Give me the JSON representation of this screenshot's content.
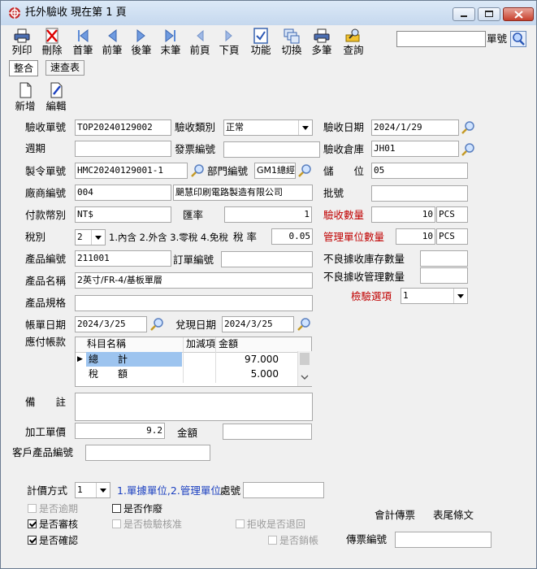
{
  "window": {
    "title": "托外驗收  現在第 1 頁"
  },
  "toolbar": {
    "buttons": [
      {
        "label": "列印",
        "icon": "printer-icon"
      },
      {
        "label": "刪除",
        "icon": "delete-icon"
      },
      {
        "label": "首筆",
        "icon": "first-record-icon"
      },
      {
        "label": "前筆",
        "icon": "prev-record-icon"
      },
      {
        "label": "後筆",
        "icon": "next-record-icon"
      },
      {
        "label": "末筆",
        "icon": "last-record-icon"
      },
      {
        "label": "前頁",
        "icon": "prev-page-icon"
      },
      {
        "label": "下頁",
        "icon": "next-page-icon"
      },
      {
        "label": "功能",
        "icon": "function-icon"
      },
      {
        "label": "切換",
        "icon": "switch-icon"
      },
      {
        "label": "多筆",
        "icon": "multi-record-icon"
      },
      {
        "label": "查詢",
        "icon": "query-icon"
      }
    ],
    "search_value": "",
    "search_label": "單號"
  },
  "tabs": [
    {
      "label": "整合"
    },
    {
      "label": "速查表"
    }
  ],
  "actions": [
    {
      "label": "新增",
      "icon": "new-doc-icon"
    },
    {
      "label": "編輯",
      "icon": "edit-doc-icon"
    }
  ],
  "form": {
    "receipt_no_label": "驗收單號",
    "receipt_no": "TOP20240129002",
    "receipt_type_label": "驗收類別",
    "receipt_type": "正常",
    "receipt_date_label": "驗收日期",
    "receipt_date": "2024/1/29",
    "period_label": "週期",
    "period": "",
    "invoice_no_label": "發票編號",
    "invoice_no": "",
    "warehouse_label": "驗收倉庫",
    "warehouse": "JH01",
    "order_no_label": "製令單號",
    "order_no": "HMC20240129001-1",
    "dept_label": "部門編號",
    "dept": "GM1總經",
    "location_label": "儲　　位",
    "location": "05",
    "vendor_label": "廠商編號",
    "vendor_code": "004",
    "vendor_name": "颶慧印刷電路製造有限公司",
    "batch_label": "批號",
    "batch": "",
    "currency_label": "付款幣別",
    "currency": "NT$",
    "rate_label": "匯率",
    "rate": "1",
    "qty_label": "驗收數量",
    "qty": "10",
    "qty_unit": "PCS",
    "tax_label": "稅別",
    "tax_value": "2",
    "tax_hint": "1.內含 2.外含 3.零稅 4.免稅",
    "tax_rate_label": "稅 率",
    "tax_rate": "0.05",
    "mgmt_qty_label": "管理單位數量",
    "mgmt_qty": "10",
    "mgmt_unit": "PCS",
    "product_no_label": "產品編號",
    "product_no": "211001",
    "order_ref_label": "訂單編號",
    "order_ref": "",
    "bad_stock_label": "不良據收庫存數量",
    "bad_stock": "",
    "product_name_label": "產品名稱",
    "product_name": "2英寸/FR-4/基板單層",
    "bad_mgmt_label": "不良據收管理數量",
    "bad_mgmt": "",
    "inspect_label": "檢驗選項",
    "inspect_value": "1",
    "spec_label": "產品規格",
    "spec": "",
    "bill_date_label": "帳單日期",
    "bill_date": "2024/3/25",
    "cash_date_label": "兌現日期",
    "cash_date": "2024/3/25",
    "payable_label": "應付帳款",
    "grid": {
      "headers": [
        "科目名稱",
        "加減項",
        "金額"
      ],
      "rows": [
        {
          "name": "總　　計",
          "adj": "",
          "amount": "97.000"
        },
        {
          "name": "稅　　額",
          "adj": "",
          "amount": "5.000"
        }
      ]
    },
    "remarks_label": "備　　註",
    "remarks": "",
    "unit_price_label": "加工單價",
    "unit_price": "9.2",
    "amount_label": "金額",
    "amount": "",
    "cust_product_label": "客戶產品編號",
    "cust_product": "",
    "pricing_label": "計價方式",
    "pricing_value": "1",
    "pricing_hint": "1.單據單位,2.管理單位",
    "dept2_label": "處號",
    "dept2": ""
  },
  "checks": {
    "overdue": "是否逾期",
    "reviewed": "是否審核",
    "confirmed": "是否確認",
    "voided": "是否作廢",
    "inspected": "是否檢驗核准",
    "returned": "拒收是否退回",
    "canceled": "是否銷帳"
  },
  "footer": {
    "accounting": "會計傳票",
    "tail": "表尾條文",
    "voucher_label": "傳票編號",
    "voucher": ""
  }
}
